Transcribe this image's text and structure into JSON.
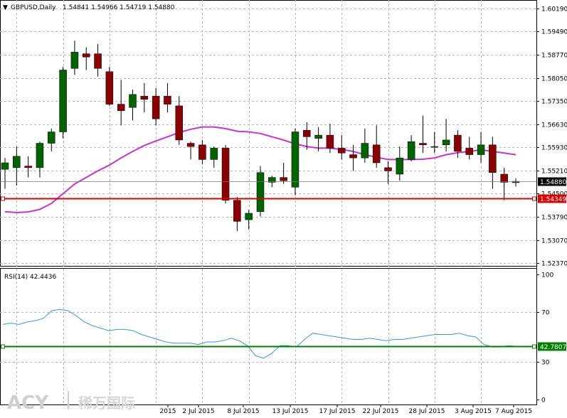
{
  "header": {
    "symbol": "GBPUSD,Daily",
    "ohlc": "1.54841 1.54966 1.54719 1.54880"
  },
  "rsi_header": "RSI(14) 42.4436",
  "logo": {
    "brand": "ACY",
    "chinese": "稀万国际"
  },
  "colors": {
    "bull": "#006400",
    "bear": "#8b0000",
    "ma": "#cc33cc",
    "rsi": "#3399dd",
    "hline_price": "#dd0000",
    "hline_rsi": "#008000",
    "current_price_box": "#000000"
  },
  "chart_data": [
    {
      "type": "candlestick",
      "symbol": "GBPUSD",
      "timeframe": "Daily",
      "y_ticks": [
        "1.60190",
        "1.59490",
        "1.58770",
        "1.58050",
        "1.57350",
        "1.56630",
        "1.55930",
        "1.55210",
        "1.54500",
        "1.53790",
        "1.53070",
        "1.52370"
      ],
      "ylim": [
        1.522,
        1.604
      ],
      "x_labels": [
        "2015",
        "2 Jul 2015",
        "8 Jul 2015",
        "13 Jul 2015",
        "17 Jul 2015",
        "22 Jul 2015",
        "28 Jul 2015",
        "3 Aug 2015",
        "7 Aug 2015"
      ],
      "x_label_index": [
        0,
        4,
        9,
        13,
        17,
        21,
        25,
        29,
        32
      ],
      "candles": [
        {
          "o": 1.5525,
          "h": 1.556,
          "l": 1.5465,
          "c": 1.5545
        },
        {
          "o": 1.553,
          "h": 1.5595,
          "l": 1.5475,
          "c": 1.5565
        },
        {
          "o": 1.5535,
          "h": 1.5565,
          "l": 1.55,
          "c": 1.553
        },
        {
          "o": 1.553,
          "h": 1.561,
          "l": 1.55,
          "c": 1.5605
        },
        {
          "o": 1.5605,
          "h": 1.565,
          "l": 1.558,
          "c": 1.564
        },
        {
          "o": 1.564,
          "h": 1.584,
          "l": 1.562,
          "c": 1.583
        },
        {
          "o": 1.5835,
          "h": 1.592,
          "l": 1.5815,
          "c": 1.5885
        },
        {
          "o": 1.588,
          "h": 1.59,
          "l": 1.583,
          "c": 1.587
        },
        {
          "o": 1.588,
          "h": 1.591,
          "l": 1.581,
          "c": 1.5835
        },
        {
          "o": 1.5825,
          "h": 1.584,
          "l": 1.572,
          "c": 1.5725
        },
        {
          "o": 1.5725,
          "h": 1.58,
          "l": 1.566,
          "c": 1.5705
        },
        {
          "o": 1.5715,
          "h": 1.577,
          "l": 1.5675,
          "c": 1.5755
        },
        {
          "o": 1.575,
          "h": 1.579,
          "l": 1.57,
          "c": 1.574
        },
        {
          "o": 1.575,
          "h": 1.5775,
          "l": 1.566,
          "c": 1.568
        },
        {
          "o": 1.575,
          "h": 1.579,
          "l": 1.57,
          "c": 1.5725
        },
        {
          "o": 1.572,
          "h": 1.575,
          "l": 1.56,
          "c": 1.5615
        },
        {
          "o": 1.5605,
          "h": 1.561,
          "l": 1.5555,
          "c": 1.5595
        },
        {
          "o": 1.56,
          "h": 1.5615,
          "l": 1.554,
          "c": 1.5555
        },
        {
          "o": 1.5555,
          "h": 1.5595,
          "l": 1.553,
          "c": 1.559
        },
        {
          "o": 1.559,
          "h": 1.56,
          "l": 1.542,
          "c": 1.543
        },
        {
          "o": 1.543,
          "h": 1.544,
          "l": 1.5335,
          "c": 1.5365
        },
        {
          "o": 1.537,
          "h": 1.54,
          "l": 1.534,
          "c": 1.539
        },
        {
          "o": 1.5395,
          "h": 1.5535,
          "l": 1.538,
          "c": 1.5515
        },
        {
          "o": 1.5485,
          "h": 1.5505,
          "l": 1.547,
          "c": 1.55
        },
        {
          "o": 1.55,
          "h": 1.5545,
          "l": 1.548,
          "c": 1.549
        },
        {
          "o": 1.547,
          "h": 1.565,
          "l": 1.5445,
          "c": 1.564
        },
        {
          "o": 1.5645,
          "h": 1.567,
          "l": 1.5585,
          "c": 1.5625
        },
        {
          "o": 1.562,
          "h": 1.5655,
          "l": 1.558,
          "c": 1.563
        },
        {
          "o": 1.563,
          "h": 1.5665,
          "l": 1.5575,
          "c": 1.559
        },
        {
          "o": 1.559,
          "h": 1.563,
          "l": 1.5555,
          "c": 1.5575
        },
        {
          "o": 1.557,
          "h": 1.56,
          "l": 1.552,
          "c": 1.556
        },
        {
          "o": 1.556,
          "h": 1.565,
          "l": 1.5545,
          "c": 1.5605
        },
        {
          "o": 1.56,
          "h": 1.566,
          "l": 1.553,
          "c": 1.5545
        },
        {
          "o": 1.553,
          "h": 1.555,
          "l": 1.548,
          "c": 1.552
        },
        {
          "o": 1.551,
          "h": 1.5595,
          "l": 1.549,
          "c": 1.556
        },
        {
          "o": 1.5555,
          "h": 1.563,
          "l": 1.555,
          "c": 1.561
        },
        {
          "o": 1.5605,
          "h": 1.569,
          "l": 1.5575,
          "c": 1.56
        },
        {
          "o": 1.5595,
          "h": 1.564,
          "l": 1.5575,
          "c": 1.5595
        },
        {
          "o": 1.56,
          "h": 1.568,
          "l": 1.558,
          "c": 1.5615
        },
        {
          "o": 1.563,
          "h": 1.5645,
          "l": 1.556,
          "c": 1.558
        },
        {
          "o": 1.559,
          "h": 1.5625,
          "l": 1.5555,
          "c": 1.557
        },
        {
          "o": 1.557,
          "h": 1.564,
          "l": 1.5545,
          "c": 1.56
        },
        {
          "o": 1.56,
          "h": 1.5625,
          "l": 1.5465,
          "c": 1.5515
        },
        {
          "o": 1.551,
          "h": 1.553,
          "l": 1.543,
          "c": 1.5485
        },
        {
          "o": 1.5484,
          "h": 1.5497,
          "l": 1.5472,
          "c": 1.5488
        }
      ],
      "ma_line": [
        1.5395,
        1.5392,
        1.5394,
        1.5402,
        1.542,
        1.545,
        1.548,
        1.55,
        1.552,
        1.5538,
        1.556,
        1.558,
        1.5598,
        1.5612,
        1.5625,
        1.5638,
        1.5648,
        1.5655,
        1.5655,
        1.565,
        1.5642,
        1.564,
        1.5635,
        1.5625,
        1.5615,
        1.5603,
        1.5595,
        1.559,
        1.559,
        1.5586,
        1.558,
        1.557,
        1.5562,
        1.5555,
        1.5555,
        1.5555,
        1.5556,
        1.556,
        1.557,
        1.5576,
        1.558,
        1.5585,
        1.558,
        1.5575,
        1.557
      ],
      "current_price": "1.54880",
      "hline_value": "1.54349",
      "hline_level": 1.54349
    },
    {
      "type": "line",
      "name": "RSI(14)",
      "value_label": "42.4436",
      "y_ticks": [
        "100",
        "70",
        "30",
        "0"
      ],
      "ylim": [
        0,
        100
      ],
      "values": [
        60,
        61,
        60,
        62,
        63,
        65,
        71,
        72,
        71,
        67,
        62,
        59,
        57,
        55,
        56,
        56,
        55,
        52,
        50,
        48,
        46,
        45,
        45,
        45,
        44,
        46,
        46,
        47,
        49,
        47,
        43,
        35,
        33,
        37,
        43,
        43,
        42,
        48,
        53,
        52,
        51,
        50,
        49,
        48,
        48,
        49,
        48,
        47,
        48,
        48,
        49,
        50,
        51,
        52,
        52,
        52,
        53,
        51,
        50,
        44,
        42,
        42,
        43,
        42.44
      ],
      "hline_value": "42.7807",
      "hline_level": 42.7807
    }
  ]
}
